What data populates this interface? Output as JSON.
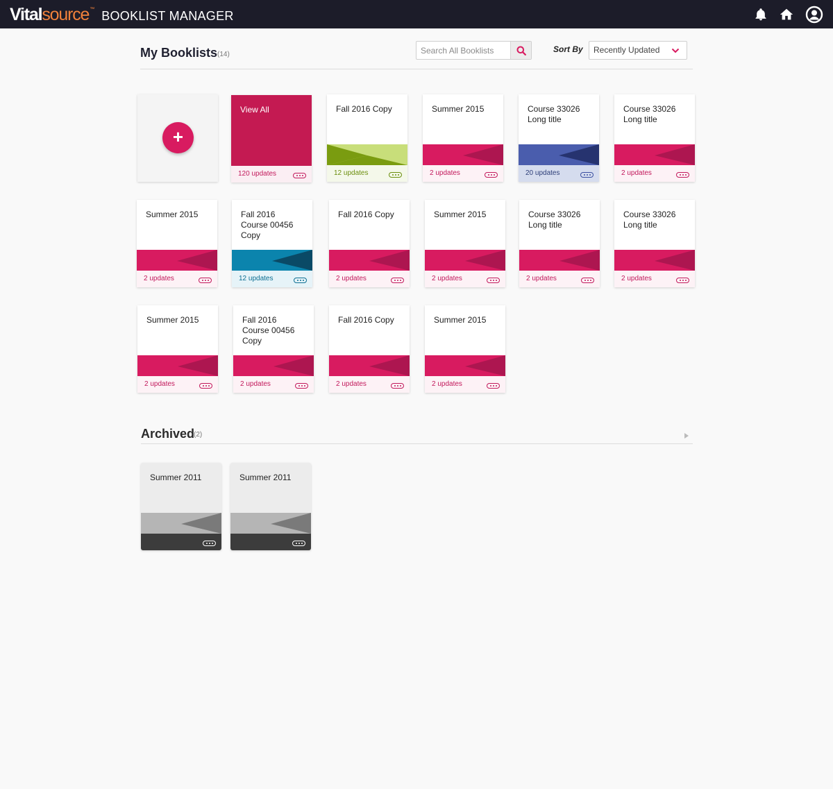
{
  "app": {
    "brand_vital": "Vital",
    "brand_source": "source",
    "brand_tm": "™",
    "product": "BOOKLIST MANAGER",
    "icons": [
      "bell-icon",
      "home-icon",
      "user-account-icon"
    ]
  },
  "header": {
    "title": "My Booklists",
    "count": "(14)",
    "search_placeholder": "Search All Booklists",
    "sort_label": "Sort By",
    "sort_value": "Recently Updated"
  },
  "colors": {
    "topbar": "#1c1c29",
    "brand_accent": "#f0813b",
    "primary": "#d81b60",
    "crimson_dark": "#c2185b"
  },
  "booklists": {
    "add_label": "+",
    "view_all": {
      "title": "View All",
      "updates": "120 updates"
    },
    "items": [
      {
        "title": "Fall 2016 Copy",
        "updates": "12 updates",
        "theme": "green"
      },
      {
        "title": "Summer 2015",
        "updates": "2 updates",
        "theme": "crimson"
      },
      {
        "title": "Course 33026\nLong title",
        "updates": "20 updates",
        "theme": "blue"
      },
      {
        "title": "Course 33026\nLong title",
        "updates": "2 updates",
        "theme": "crimson"
      },
      {
        "title": "Summer 2015",
        "updates": "2 updates",
        "theme": "crimson"
      },
      {
        "title": "Fall 2016\nCourse 00456\nCopy",
        "updates": "12 updates",
        "theme": "teal"
      },
      {
        "title": "Fall 2016 Copy",
        "updates": "2 updates",
        "theme": "crimson"
      },
      {
        "title": "Summer 2015",
        "updates": "2 updates",
        "theme": "crimson"
      },
      {
        "title": "Course 33026\nLong title",
        "updates": "2 updates",
        "theme": "crimson"
      },
      {
        "title": "Course 33026\nLong title",
        "updates": "2 updates",
        "theme": "crimson"
      },
      {
        "title": "Summer 2015",
        "updates": "2 updates",
        "theme": "crimson"
      },
      {
        "title": "Fall 2016\nCourse 00456\nCopy",
        "updates": "2 updates",
        "theme": "crimson"
      },
      {
        "title": "Fall 2016 Copy",
        "updates": "2 updates",
        "theme": "crimson"
      },
      {
        "title": "Summer 2015",
        "updates": "2 updates",
        "theme": "crimson"
      }
    ]
  },
  "archived": {
    "title": "Archived",
    "count": "(2)",
    "items": [
      {
        "title": "Summer 2011",
        "theme": "gray"
      },
      {
        "title": "Summer 2011",
        "theme": "gray"
      }
    ]
  }
}
